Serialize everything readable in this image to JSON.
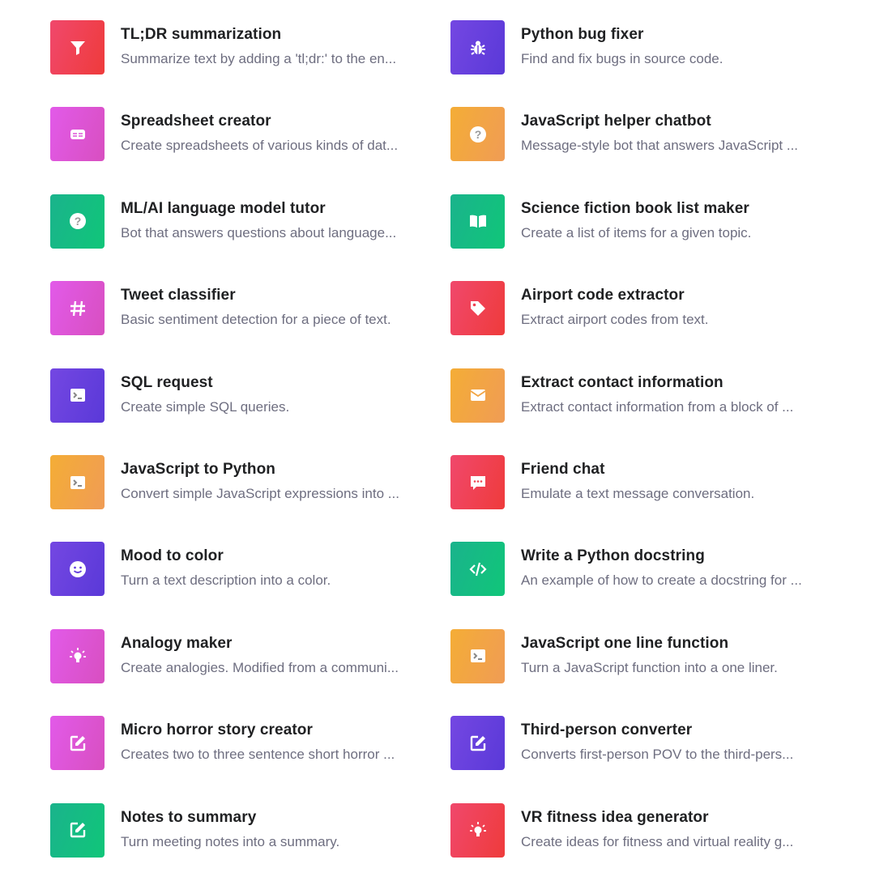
{
  "colors": {
    "red": [
      "#f0486c",
      "#ef3b3b"
    ],
    "pink": [
      "#e25ae9",
      "#d84fc0"
    ],
    "green": [
      "#1ab38c",
      "#10c679"
    ],
    "purple": [
      "#7447e2",
      "#5a39d8"
    ],
    "orange": [
      "#f4ad36",
      "#f09c55"
    ]
  },
  "items": [
    {
      "title": "TL;DR summarization",
      "description": "Summarize text by adding a 'tl;dr:' to the en...",
      "icon": "funnel-icon",
      "color": "red"
    },
    {
      "title": "Python bug fixer",
      "description": "Find and fix bugs in source code.",
      "icon": "bug-icon",
      "color": "purple"
    },
    {
      "title": "Spreadsheet creator",
      "description": "Create spreadsheets of various kinds of dat...",
      "icon": "table-icon",
      "color": "pink"
    },
    {
      "title": "JavaScript helper chatbot",
      "description": "Message-style bot that answers JavaScript ...",
      "icon": "question-icon",
      "color": "orange"
    },
    {
      "title": "ML/AI language model tutor",
      "description": "Bot that answers questions about language...",
      "icon": "question-icon",
      "color": "green"
    },
    {
      "title": "Science fiction book list maker",
      "description": "Create a list of items for a given topic.",
      "icon": "book-icon",
      "color": "green"
    },
    {
      "title": "Tweet classifier",
      "description": "Basic sentiment detection for a piece of text.",
      "icon": "hash-icon",
      "color": "pink"
    },
    {
      "title": "Airport code extractor",
      "description": "Extract airport codes from text.",
      "icon": "tag-icon",
      "color": "red"
    },
    {
      "title": "SQL request",
      "description": "Create simple SQL queries.",
      "icon": "terminal-icon",
      "color": "purple"
    },
    {
      "title": "Extract contact information",
      "description": "Extract contact information from a block of ...",
      "icon": "mail-icon",
      "color": "orange"
    },
    {
      "title": "JavaScript to Python",
      "description": "Convert simple JavaScript expressions into ...",
      "icon": "terminal-icon",
      "color": "orange"
    },
    {
      "title": "Friend chat",
      "description": "Emulate a text message conversation.",
      "icon": "chat-icon",
      "color": "red"
    },
    {
      "title": "Mood to color",
      "description": "Turn a text description into a color.",
      "icon": "smile-icon",
      "color": "purple"
    },
    {
      "title": "Write a Python docstring",
      "description": "An example of how to create a docstring for ...",
      "icon": "code-icon",
      "color": "green"
    },
    {
      "title": "Analogy maker",
      "description": "Create analogies. Modified from a communi...",
      "icon": "bulb-icon",
      "color": "pink"
    },
    {
      "title": "JavaScript one line function",
      "description": "Turn a JavaScript function into a one liner.",
      "icon": "terminal-icon",
      "color": "orange"
    },
    {
      "title": "Micro horror story creator",
      "description": "Creates two to three sentence short horror ...",
      "icon": "edit-icon",
      "color": "pink"
    },
    {
      "title": "Third-person converter",
      "description": "Converts first-person POV to the third-pers...",
      "icon": "edit-icon",
      "color": "purple"
    },
    {
      "title": "Notes to summary",
      "description": "Turn meeting notes into a summary.",
      "icon": "edit-icon",
      "color": "green"
    },
    {
      "title": "VR fitness idea generator",
      "description": "Create ideas for fitness and virtual reality g...",
      "icon": "bulb-icon",
      "color": "red"
    }
  ]
}
